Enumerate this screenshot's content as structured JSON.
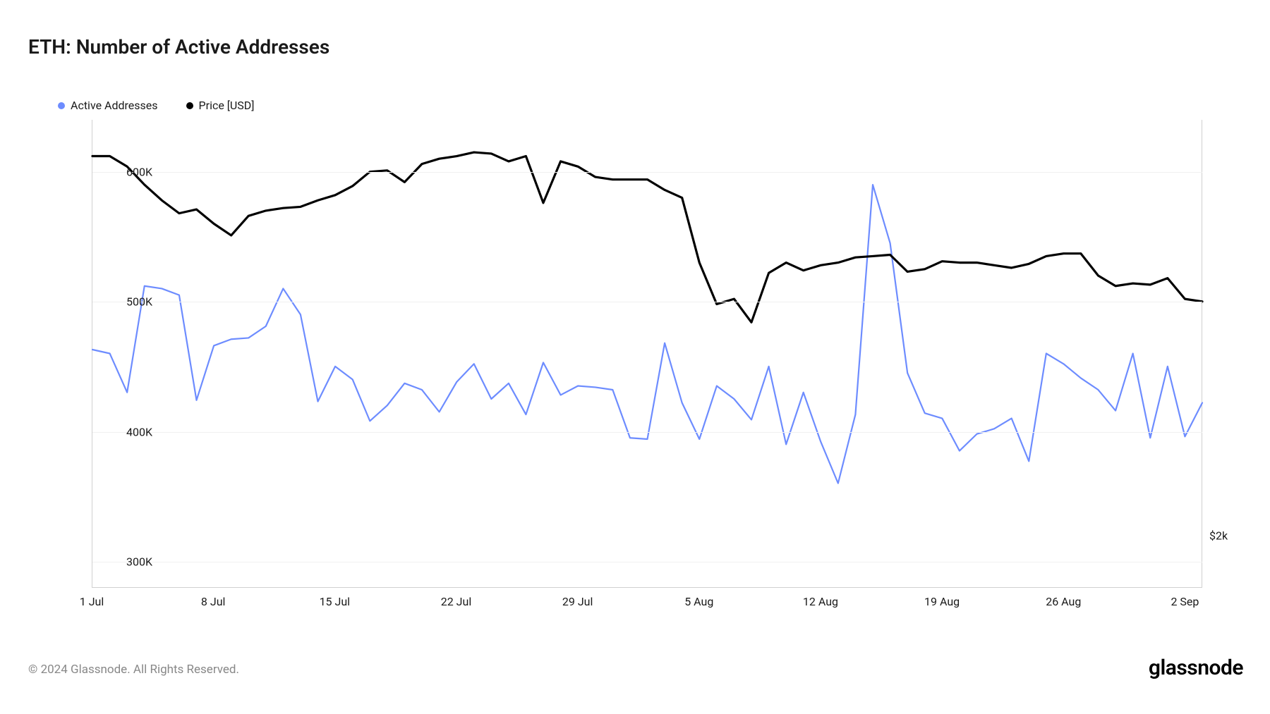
{
  "title": "ETH: Number of Active Addresses",
  "legend": {
    "series1": {
      "label": "Active Addresses",
      "color": "#6d8cff"
    },
    "series2": {
      "label": "Price [USD]",
      "color": "#000000"
    }
  },
  "axes": {
    "y_left_ticks": [
      "300K",
      "400K",
      "500K",
      "600K"
    ],
    "y_right_ticks": [
      "$2k"
    ],
    "x_ticks": [
      "1 Jul",
      "8 Jul",
      "15 Jul",
      "22 Jul",
      "29 Jul",
      "5 Aug",
      "12 Aug",
      "19 Aug",
      "26 Aug",
      "2 Sep"
    ]
  },
  "footer": {
    "copyright": "© 2024 Glassnode. All Rights Reserved.",
    "brand": "glassnode"
  },
  "chart_data": {
    "type": "line",
    "title": "ETH: Number of Active Addresses",
    "xlabel": "",
    "y_left_label": "",
    "y_right_label": "",
    "y_left_lim": [
      280000,
      640000
    ],
    "y_right_lim": [
      1800,
      3600
    ],
    "x": [
      "1 Jul",
      "2 Jul",
      "3 Jul",
      "4 Jul",
      "5 Jul",
      "6 Jul",
      "7 Jul",
      "8 Jul",
      "9 Jul",
      "10 Jul",
      "11 Jul",
      "12 Jul",
      "13 Jul",
      "14 Jul",
      "15 Jul",
      "16 Jul",
      "17 Jul",
      "18 Jul",
      "19 Jul",
      "20 Jul",
      "21 Jul",
      "22 Jul",
      "23 Jul",
      "24 Jul",
      "25 Jul",
      "26 Jul",
      "27 Jul",
      "28 Jul",
      "29 Jul",
      "30 Jul",
      "31 Jul",
      "1 Aug",
      "2 Aug",
      "3 Aug",
      "4 Aug",
      "5 Aug",
      "6 Aug",
      "7 Aug",
      "8 Aug",
      "9 Aug",
      "10 Aug",
      "11 Aug",
      "12 Aug",
      "13 Aug",
      "14 Aug",
      "15 Aug",
      "16 Aug",
      "17 Aug",
      "18 Aug",
      "19 Aug",
      "20 Aug",
      "21 Aug",
      "22 Aug",
      "23 Aug",
      "24 Aug",
      "25 Aug",
      "26 Aug",
      "27 Aug",
      "28 Aug",
      "29 Aug",
      "30 Aug",
      "31 Aug",
      "1 Sep",
      "2 Sep",
      "3 Sep"
    ],
    "series": [
      {
        "name": "Active Addresses",
        "axis": "left",
        "color": "#6d8cff",
        "values": [
          463000,
          460000,
          430000,
          512000,
          510000,
          505000,
          424000,
          466000,
          471000,
          472000,
          481000,
          510000,
          490000,
          423000,
          450000,
          440000,
          408000,
          420000,
          437000,
          432000,
          415000,
          438000,
          452000,
          425000,
          437000,
          413000,
          453000,
          428000,
          435000,
          434000,
          432000,
          395000,
          394000,
          468000,
          422000,
          394000,
          435000,
          425000,
          409000,
          450000,
          390000,
          430000,
          392000,
          360000,
          413000,
          590000,
          545000,
          445000,
          414000,
          410000,
          385000,
          398000,
          402000,
          410000,
          377000,
          460000,
          452000,
          441000,
          432000,
          416000,
          460000,
          395000,
          450000,
          396000,
          422000
        ]
      },
      {
        "name": "Price [USD]",
        "axis": "right",
        "color": "#000000",
        "values": [
          3460,
          3460,
          3420,
          3350,
          3290,
          3240,
          3255,
          3200,
          3155,
          3230,
          3250,
          3260,
          3265,
          3290,
          3310,
          3345,
          3400,
          3405,
          3360,
          3430,
          3450,
          3460,
          3475,
          3470,
          3440,
          3460,
          3280,
          3440,
          3420,
          3380,
          3370,
          3370,
          3370,
          3330,
          3300,
          3050,
          2890,
          2910,
          2820,
          3010,
          3050,
          3020,
          3040,
          3050,
          3070,
          3075,
          3080,
          3015,
          3025,
          3055,
          3050,
          3050,
          3040,
          3030,
          3045,
          3075,
          3085,
          3085,
          3000,
          2960,
          2970,
          2965,
          2990,
          2910,
          2900
        ]
      }
    ],
    "grid": {
      "y": true,
      "x": false
    },
    "legend_position": "top-left"
  }
}
